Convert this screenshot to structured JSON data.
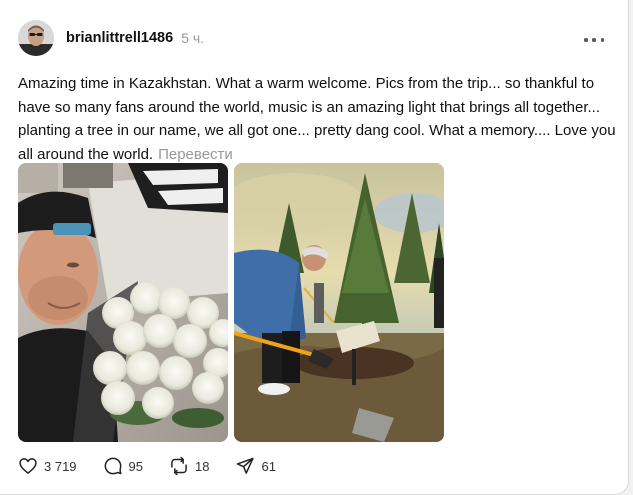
{
  "post": {
    "username": "brianlittrell1486",
    "time": "5 ч.",
    "text": "Amazing time in Kazakhstan. What a warm welcome. Pics from the trip... so thankful to have so many fans around the world, music is an amazing light that brings all together... planting a tree in our name, we all got one... pretty dang cool. What a memory.... Love you all around the world.",
    "translate_label": "Перевести"
  },
  "actions": {
    "likes": "3 719",
    "comments": "95",
    "reposts": "18",
    "shares": "61"
  },
  "icons": {
    "more": "more-horizontal-icon",
    "like": "heart-icon",
    "comment": "comment-bubble-icon",
    "repost": "repost-icon",
    "share": "send-icon"
  }
}
